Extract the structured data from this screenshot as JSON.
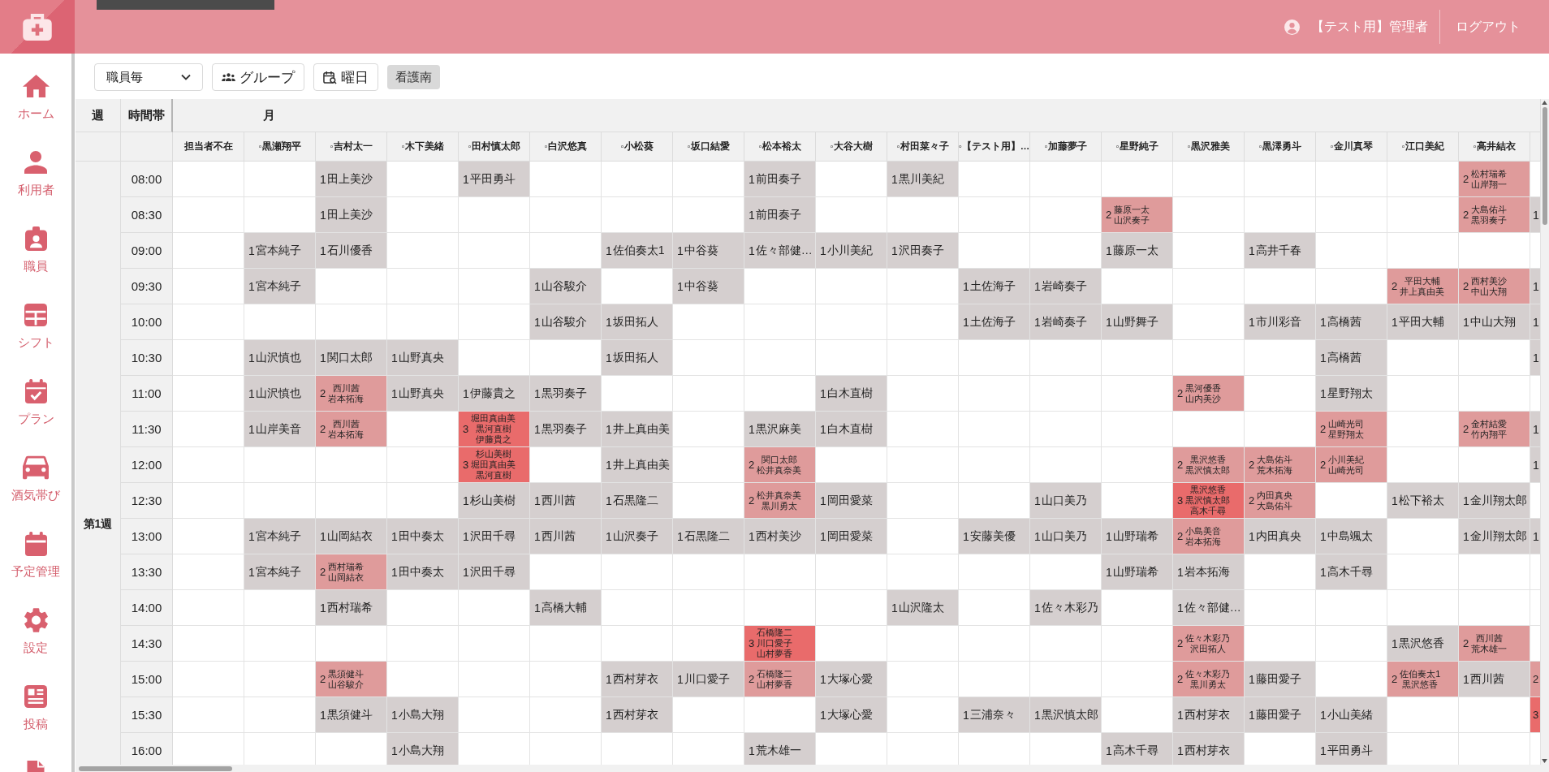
{
  "header": {
    "user_name": "【テスト用】管理者",
    "logout": "ログアウト"
  },
  "sidebar": {
    "items": [
      {
        "label": "ホーム"
      },
      {
        "label": "利用者"
      },
      {
        "label": "職員"
      },
      {
        "label": "シフト"
      },
      {
        "label": "プラン"
      },
      {
        "label": "酒気帯び"
      },
      {
        "label": "予定管理"
      },
      {
        "label": "設定"
      },
      {
        "label": "投稿"
      }
    ],
    "more_items_below": true
  },
  "toolbar": {
    "view_select": "職員毎",
    "buttons": [
      {
        "label": "グループ"
      },
      {
        "label": "曜日"
      }
    ],
    "filter_tag": "看護南"
  },
  "schedule": {
    "headers": {
      "week": "週",
      "time": "時間帯",
      "day": "月"
    },
    "staff": [
      "担当者不在",
      "◦黒瀬翔平",
      "◦吉村太一",
      "◦木下美緒",
      "◦田村慎太郎",
      "◦白沢悠真",
      "◦小松葵",
      "◦坂口結愛",
      "◦松本裕太",
      "◦大谷大樹",
      "◦村田菜々子",
      "◦【テスト用】…",
      "◦加藤夢子",
      "◦星野純子",
      "◦黒沢雅美",
      "◦黒澤勇斗",
      "◦金川真琴",
      "◦江口美紀",
      "◦高井結衣"
    ],
    "week_label": "第1週",
    "rows": [
      {
        "time": "08:00",
        "cells": [
          null,
          null,
          {
            "kind": "single",
            "count": "1",
            "names": [
              "田上美沙"
            ]
          },
          null,
          {
            "kind": "single",
            "count": "1",
            "names": [
              "平田勇斗"
            ]
          },
          null,
          null,
          null,
          {
            "kind": "single",
            "count": "1",
            "names": [
              "前田奏子"
            ]
          },
          null,
          {
            "kind": "single",
            "count": "1",
            "names": [
              "黒川美紀"
            ]
          },
          null,
          null,
          null,
          null,
          null,
          null,
          null,
          {
            "kind": "pair",
            "count": "2",
            "names": [
              "松村瑞希",
              "山岸翔一"
            ]
          },
          null
        ]
      },
      {
        "time": "08:30",
        "cells": [
          null,
          null,
          {
            "kind": "single",
            "count": "1",
            "names": [
              "田上美沙"
            ]
          },
          null,
          null,
          null,
          null,
          null,
          {
            "kind": "single",
            "count": "1",
            "names": [
              "前田奏子"
            ]
          },
          null,
          null,
          null,
          null,
          {
            "kind": "pair",
            "count": "2",
            "names": [
              "藤原一太",
              "山沢奏子"
            ]
          },
          null,
          null,
          null,
          null,
          {
            "kind": "pair",
            "count": "2",
            "names": [
              "大島佑斗",
              "黒羽奏子"
            ]
          },
          {
            "kind": "single",
            "count": "1"
          }
        ]
      },
      {
        "time": "09:00",
        "cells": [
          null,
          {
            "kind": "single",
            "count": "1",
            "names": [
              "宮本純子"
            ]
          },
          {
            "kind": "single",
            "count": "1",
            "names": [
              "石川優香"
            ]
          },
          null,
          null,
          null,
          {
            "kind": "single",
            "count": "1",
            "names": [
              "佐伯奏太1"
            ]
          },
          {
            "kind": "single",
            "count": "1",
            "names": [
              "中谷葵"
            ]
          },
          {
            "kind": "single",
            "count": "1",
            "names": [
              "佐々部健…"
            ]
          },
          {
            "kind": "single",
            "count": "1",
            "names": [
              "小川美紀"
            ]
          },
          {
            "kind": "single",
            "count": "1",
            "names": [
              "沢田奏子"
            ]
          },
          null,
          null,
          {
            "kind": "single",
            "count": "1",
            "names": [
              "藤原一太"
            ]
          },
          null,
          {
            "kind": "single",
            "count": "1",
            "names": [
              "高井千春"
            ]
          },
          null,
          null,
          null,
          null
        ]
      },
      {
        "time": "09:30",
        "cells": [
          null,
          {
            "kind": "single",
            "count": "1",
            "names": [
              "宮本純子"
            ]
          },
          null,
          null,
          null,
          {
            "kind": "single",
            "count": "1",
            "names": [
              "山谷駿介"
            ]
          },
          null,
          {
            "kind": "single",
            "count": "1",
            "names": [
              "中谷葵"
            ]
          },
          null,
          null,
          null,
          {
            "kind": "single",
            "count": "1",
            "names": [
              "土佐海子"
            ]
          },
          {
            "kind": "single",
            "count": "1",
            "names": [
              "岩崎奏子"
            ]
          },
          null,
          null,
          null,
          null,
          {
            "kind": "pair",
            "count": "2",
            "names": [
              "平田大輔",
              "井上真由美"
            ]
          },
          {
            "kind": "pair",
            "count": "2",
            "names": [
              "西村美沙",
              "中山大翔"
            ]
          },
          {
            "kind": "single",
            "count": "1"
          }
        ]
      },
      {
        "time": "10:00",
        "cells": [
          null,
          null,
          null,
          null,
          null,
          {
            "kind": "single",
            "count": "1",
            "names": [
              "山谷駿介"
            ]
          },
          {
            "kind": "single",
            "count": "1",
            "names": [
              "坂田拓人"
            ]
          },
          null,
          null,
          null,
          null,
          {
            "kind": "single",
            "count": "1",
            "names": [
              "土佐海子"
            ]
          },
          {
            "kind": "single",
            "count": "1",
            "names": [
              "岩崎奏子"
            ]
          },
          {
            "kind": "single",
            "count": "1",
            "names": [
              "山野舞子"
            ]
          },
          null,
          {
            "kind": "single",
            "count": "1",
            "names": [
              "市川彩音"
            ]
          },
          {
            "kind": "single",
            "count": "1",
            "names": [
              "高橋茜"
            ]
          },
          {
            "kind": "single",
            "count": "1",
            "names": [
              "平田大輔"
            ]
          },
          {
            "kind": "single",
            "count": "1",
            "names": [
              "中山大翔"
            ]
          },
          {
            "kind": "single",
            "count": "1"
          }
        ]
      },
      {
        "time": "10:30",
        "cells": [
          null,
          {
            "kind": "single",
            "count": "1",
            "names": [
              "山沢慎也"
            ]
          },
          {
            "kind": "single",
            "count": "1",
            "names": [
              "関口太郎"
            ]
          },
          {
            "kind": "single",
            "count": "1",
            "names": [
              "山野真央"
            ]
          },
          null,
          null,
          {
            "kind": "single",
            "count": "1",
            "names": [
              "坂田拓人"
            ]
          },
          null,
          null,
          null,
          null,
          null,
          null,
          null,
          null,
          null,
          {
            "kind": "single",
            "count": "1",
            "names": [
              "高橋茜"
            ]
          },
          null,
          null,
          {
            "kind": "single",
            "count": "1"
          }
        ]
      },
      {
        "time": "11:00",
        "cells": [
          null,
          {
            "kind": "single",
            "count": "1",
            "names": [
              "山沢慎也"
            ]
          },
          {
            "kind": "pair",
            "count": "2",
            "names": [
              "西川茜",
              "岩本拓海"
            ]
          },
          {
            "kind": "single",
            "count": "1",
            "names": [
              "山野真央"
            ]
          },
          {
            "kind": "single",
            "count": "1",
            "names": [
              "伊藤貴之"
            ]
          },
          {
            "kind": "single",
            "count": "1",
            "names": [
              "黒羽奏子"
            ]
          },
          null,
          null,
          null,
          {
            "kind": "single",
            "count": "1",
            "names": [
              "白木直樹"
            ]
          },
          null,
          null,
          null,
          null,
          {
            "kind": "pair",
            "count": "2",
            "names": [
              "黒河優香",
              "山内美沙"
            ]
          },
          null,
          {
            "kind": "single",
            "count": "1",
            "names": [
              "星野翔太"
            ]
          },
          null,
          null,
          null
        ]
      },
      {
        "time": "11:30",
        "cells": [
          null,
          {
            "kind": "single",
            "count": "1",
            "names": [
              "山岸美音"
            ]
          },
          {
            "kind": "pair",
            "count": "2",
            "names": [
              "西川茜",
              "岩本拓海"
            ]
          },
          null,
          {
            "kind": "triple",
            "count": "3",
            "names": [
              "堀田真由美",
              "黒河直樹",
              "伊藤貴之"
            ]
          },
          {
            "kind": "single",
            "count": "1",
            "names": [
              "黒羽奏子"
            ]
          },
          {
            "kind": "single",
            "count": "1",
            "names": [
              "井上真由美"
            ]
          },
          null,
          {
            "kind": "single",
            "count": "1",
            "names": [
              "黒沢麻美"
            ]
          },
          {
            "kind": "single",
            "count": "1",
            "names": [
              "白木直樹"
            ]
          },
          null,
          null,
          null,
          null,
          null,
          null,
          {
            "kind": "pair",
            "count": "2",
            "names": [
              "山崎光司",
              "星野翔太"
            ]
          },
          null,
          {
            "kind": "pair",
            "count": "2",
            "names": [
              "金村結愛",
              "竹内翔平"
            ]
          },
          {
            "kind": "single",
            "count": "1"
          }
        ]
      },
      {
        "time": "12:00",
        "cells": [
          null,
          null,
          null,
          null,
          {
            "kind": "triple",
            "count": "3",
            "names": [
              "杉山美樹",
              "堀田真由美",
              "黒河直樹"
            ]
          },
          null,
          {
            "kind": "single",
            "count": "1",
            "names": [
              "井上真由美"
            ]
          },
          null,
          {
            "kind": "pair",
            "count": "2",
            "names": [
              "関口太郎",
              "松井真奈美"
            ]
          },
          null,
          null,
          null,
          null,
          null,
          {
            "kind": "pair",
            "count": "2",
            "names": [
              "黒沢悠香",
              "黒沢慎太郎"
            ]
          },
          {
            "kind": "pair",
            "count": "2",
            "names": [
              "大島佑斗",
              "荒木拓海"
            ]
          },
          {
            "kind": "pair",
            "count": "2",
            "names": [
              "小川美紀",
              "山崎光司"
            ]
          },
          null,
          null,
          {
            "kind": "single",
            "count": "1"
          }
        ]
      },
      {
        "time": "12:30",
        "cells": [
          null,
          null,
          null,
          null,
          {
            "kind": "single",
            "count": "1",
            "names": [
              "杉山美樹"
            ]
          },
          {
            "kind": "single",
            "count": "1",
            "names": [
              "西川茜"
            ]
          },
          {
            "kind": "single",
            "count": "1",
            "names": [
              "石黒隆二"
            ]
          },
          null,
          {
            "kind": "pair",
            "count": "2",
            "names": [
              "松井真奈美",
              "黒川勇太"
            ]
          },
          {
            "kind": "single",
            "count": "1",
            "names": [
              "岡田愛菜"
            ]
          },
          null,
          null,
          {
            "kind": "single",
            "count": "1",
            "names": [
              "山口美乃"
            ]
          },
          null,
          {
            "kind": "triple",
            "count": "3",
            "names": [
              "黒沢悠香",
              "黒沢慎太郎",
              "高木千尋"
            ]
          },
          {
            "kind": "pair",
            "count": "2",
            "names": [
              "内田真央",
              "大島佑斗"
            ]
          },
          null,
          {
            "kind": "single",
            "count": "1",
            "names": [
              "松下裕太"
            ]
          },
          {
            "kind": "single",
            "count": "1",
            "names": [
              "金川翔太郎"
            ]
          },
          null
        ]
      },
      {
        "time": "13:00",
        "cells": [
          null,
          {
            "kind": "single",
            "count": "1",
            "names": [
              "宮本純子"
            ]
          },
          {
            "kind": "single",
            "count": "1",
            "names": [
              "山岡結衣"
            ]
          },
          {
            "kind": "single",
            "count": "1",
            "names": [
              "田中奏太"
            ]
          },
          {
            "kind": "single",
            "count": "1",
            "names": [
              "沢田千尋"
            ]
          },
          {
            "kind": "single",
            "count": "1",
            "names": [
              "西川茜"
            ]
          },
          {
            "kind": "single",
            "count": "1",
            "names": [
              "山沢奏子"
            ]
          },
          {
            "kind": "single",
            "count": "1",
            "names": [
              "石黒隆二"
            ]
          },
          {
            "kind": "single",
            "count": "1",
            "names": [
              "西村美沙"
            ]
          },
          {
            "kind": "single",
            "count": "1",
            "names": [
              "岡田愛菜"
            ]
          },
          null,
          {
            "kind": "single",
            "count": "1",
            "names": [
              "安藤美優"
            ]
          },
          {
            "kind": "single",
            "count": "1",
            "names": [
              "山口美乃"
            ]
          },
          {
            "kind": "single",
            "count": "1",
            "names": [
              "山野瑞希"
            ]
          },
          {
            "kind": "pair",
            "count": "2",
            "names": [
              "小島美音",
              "岩本拓海"
            ]
          },
          {
            "kind": "single",
            "count": "1",
            "names": [
              "内田真央"
            ]
          },
          {
            "kind": "single",
            "count": "1",
            "names": [
              "中島颯太"
            ]
          },
          null,
          {
            "kind": "single",
            "count": "1",
            "names": [
              "金川翔太郎"
            ]
          },
          {
            "kind": "single",
            "count": "1"
          }
        ]
      },
      {
        "time": "13:30",
        "cells": [
          null,
          {
            "kind": "single",
            "count": "1",
            "names": [
              "宮本純子"
            ]
          },
          {
            "kind": "pair",
            "count": "2",
            "names": [
              "西村瑞希",
              "山岡結衣"
            ]
          },
          {
            "kind": "single",
            "count": "1",
            "names": [
              "田中奏太"
            ]
          },
          {
            "kind": "single",
            "count": "1",
            "names": [
              "沢田千尋"
            ]
          },
          null,
          null,
          null,
          null,
          null,
          null,
          null,
          null,
          {
            "kind": "single",
            "count": "1",
            "names": [
              "山野瑞希"
            ]
          },
          {
            "kind": "single",
            "count": "1",
            "names": [
              "岩本拓海"
            ]
          },
          null,
          {
            "kind": "single",
            "count": "1",
            "names": [
              "高木千尋"
            ]
          },
          null,
          null,
          null
        ]
      },
      {
        "time": "14:00",
        "cells": [
          null,
          null,
          {
            "kind": "single",
            "count": "1",
            "names": [
              "西村瑞希"
            ]
          },
          null,
          null,
          {
            "kind": "single",
            "count": "1",
            "names": [
              "高橋大輔"
            ]
          },
          null,
          null,
          null,
          null,
          {
            "kind": "single",
            "count": "1",
            "names": [
              "山沢隆太"
            ]
          },
          null,
          {
            "kind": "single",
            "count": "1",
            "names": [
              "佐々木彩乃"
            ]
          },
          null,
          {
            "kind": "single",
            "count": "1",
            "names": [
              "佐々部健…"
            ]
          },
          null,
          null,
          null,
          null,
          null
        ]
      },
      {
        "time": "14:30",
        "cells": [
          null,
          null,
          null,
          null,
          null,
          null,
          null,
          null,
          {
            "kind": "triple",
            "count": "3",
            "names": [
              "石橋隆二",
              "川口愛子",
              "山村夢香"
            ]
          },
          null,
          null,
          null,
          null,
          null,
          {
            "kind": "pair",
            "count": "2",
            "names": [
              "佐々木彩乃",
              "沢田拓人"
            ]
          },
          null,
          null,
          {
            "kind": "single",
            "count": "1",
            "names": [
              "黒沢悠香"
            ]
          },
          {
            "kind": "pair",
            "count": "2",
            "names": [
              "西川茜",
              "荒木雄一"
            ]
          },
          null
        ]
      },
      {
        "time": "15:00",
        "cells": [
          null,
          null,
          {
            "kind": "pair",
            "count": "2",
            "names": [
              "黒須健斗",
              "山谷駿介"
            ]
          },
          null,
          null,
          null,
          {
            "kind": "single",
            "count": "1",
            "names": [
              "西村芽衣"
            ]
          },
          {
            "kind": "single",
            "count": "1",
            "names": [
              "川口愛子"
            ]
          },
          {
            "kind": "pair",
            "count": "2",
            "names": [
              "石橋隆二",
              "山村夢香"
            ]
          },
          {
            "kind": "single",
            "count": "1",
            "names": [
              "大塚心愛"
            ]
          },
          null,
          null,
          null,
          null,
          {
            "kind": "pair",
            "count": "2",
            "names": [
              "佐々木彩乃",
              "黒川勇太"
            ]
          },
          {
            "kind": "single",
            "count": "1",
            "names": [
              "藤田愛子"
            ]
          },
          null,
          {
            "kind": "pair",
            "count": "2",
            "names": [
              "佐伯奏太1",
              "黒沢悠香"
            ]
          },
          {
            "kind": "single",
            "count": "1",
            "names": [
              "西川茜"
            ]
          },
          {
            "kind": "pair",
            "count": "2"
          }
        ]
      },
      {
        "time": "15:30",
        "cells": [
          null,
          null,
          {
            "kind": "single",
            "count": "1",
            "names": [
              "黒須健斗"
            ]
          },
          {
            "kind": "single",
            "count": "1",
            "names": [
              "小島大翔"
            ]
          },
          null,
          null,
          {
            "kind": "single",
            "count": "1",
            "names": [
              "西村芽衣"
            ]
          },
          null,
          null,
          {
            "kind": "single",
            "count": "1",
            "names": [
              "大塚心愛"
            ]
          },
          null,
          {
            "kind": "single",
            "count": "1",
            "names": [
              "三浦奈々"
            ]
          },
          {
            "kind": "single",
            "count": "1",
            "names": [
              "黒沢慎太郎"
            ]
          },
          null,
          {
            "kind": "single",
            "count": "1",
            "names": [
              "西村芽衣"
            ]
          },
          {
            "kind": "single",
            "count": "1",
            "names": [
              "藤田愛子"
            ]
          },
          {
            "kind": "single",
            "count": "1",
            "names": [
              "小山美緒"
            ]
          },
          null,
          null,
          {
            "kind": "triple",
            "count": "3"
          }
        ]
      },
      {
        "time": "16:00",
        "cells": [
          null,
          null,
          null,
          {
            "kind": "single",
            "count": "1",
            "names": [
              "小島大翔"
            ]
          },
          null,
          null,
          null,
          null,
          {
            "kind": "single",
            "count": "1",
            "names": [
              "荒木雄一"
            ]
          },
          null,
          null,
          null,
          null,
          {
            "kind": "single",
            "count": "1",
            "names": [
              "高木千尋"
            ]
          },
          {
            "kind": "single",
            "count": "1",
            "names": [
              "西村芽衣"
            ]
          },
          null,
          {
            "kind": "single",
            "count": "1",
            "names": [
              "平田勇斗"
            ]
          },
          null,
          null,
          null
        ]
      }
    ]
  }
}
